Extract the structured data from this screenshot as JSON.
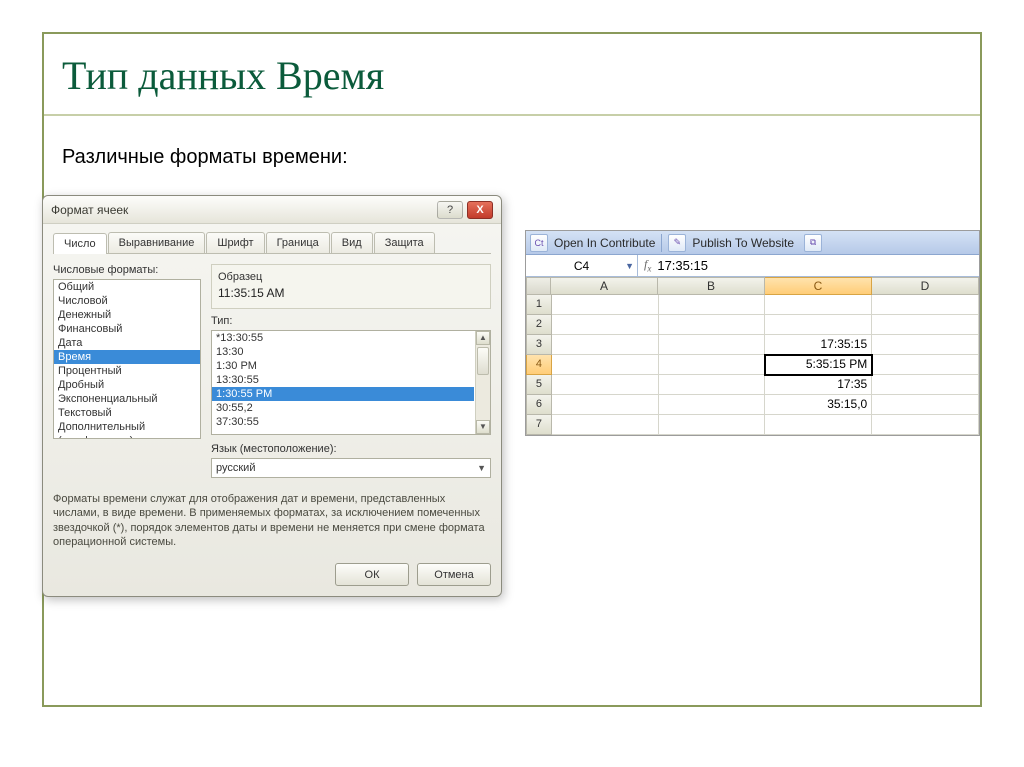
{
  "slide": {
    "title": "Тип данных Время",
    "subtitle": "Различные форматы времени:"
  },
  "dialog": {
    "title": "Формат ячеек",
    "help_label": "?",
    "close_label": "X",
    "tabs": [
      "Число",
      "Выравнивание",
      "Шрифт",
      "Граница",
      "Вид",
      "Защита"
    ],
    "formats_label": "Числовые форматы:",
    "formats": [
      "Общий",
      "Числовой",
      "Денежный",
      "Финансовый",
      "Дата",
      "Время",
      "Процентный",
      "Дробный",
      "Экспоненциальный",
      "Текстовый",
      "Дополнительный",
      "(все форматы)"
    ],
    "formats_selected_index": 5,
    "sample_label": "Образец",
    "sample_value": "11:35:15 AM",
    "type_label": "Тип:",
    "type_items": [
      "*13:30:55",
      "13:30",
      "1:30 PM",
      "13:30:55",
      "1:30:55 PM",
      "30:55,2",
      "37:30:55"
    ],
    "type_selected_index": 4,
    "locale_label": "Язык (местоположение):",
    "locale_value": "русский",
    "description": "Форматы времени служат для отображения дат и времени, представленных числами, в виде времени. В применяемых форматах, за исключением помеченных звездочкой (*), порядок элементов даты и времени не меняется при смене формата операционной системы.",
    "ok_label": "ОК",
    "cancel_label": "Отмена"
  },
  "excel": {
    "toolbar": {
      "ct_icon": "Ct",
      "open_label": "Open In Contribute",
      "pub_icon": "✎",
      "publish_label": "Publish To Website",
      "tail_icon": "⧉"
    },
    "namebox": "C4",
    "formula": "17:35:15",
    "columns": [
      "A",
      "B",
      "C",
      "D"
    ],
    "selected_col_index": 2,
    "rows": [
      {
        "num": "1",
        "c": ""
      },
      {
        "num": "2",
        "c": ""
      },
      {
        "num": "3",
        "c": "17:35:15"
      },
      {
        "num": "4",
        "c": "5:35:15 PM"
      },
      {
        "num": "5",
        "c": "17:35"
      },
      {
        "num": "6",
        "c": "35:15,0"
      },
      {
        "num": "7",
        "c": ""
      }
    ],
    "selected_row_index": 3
  }
}
